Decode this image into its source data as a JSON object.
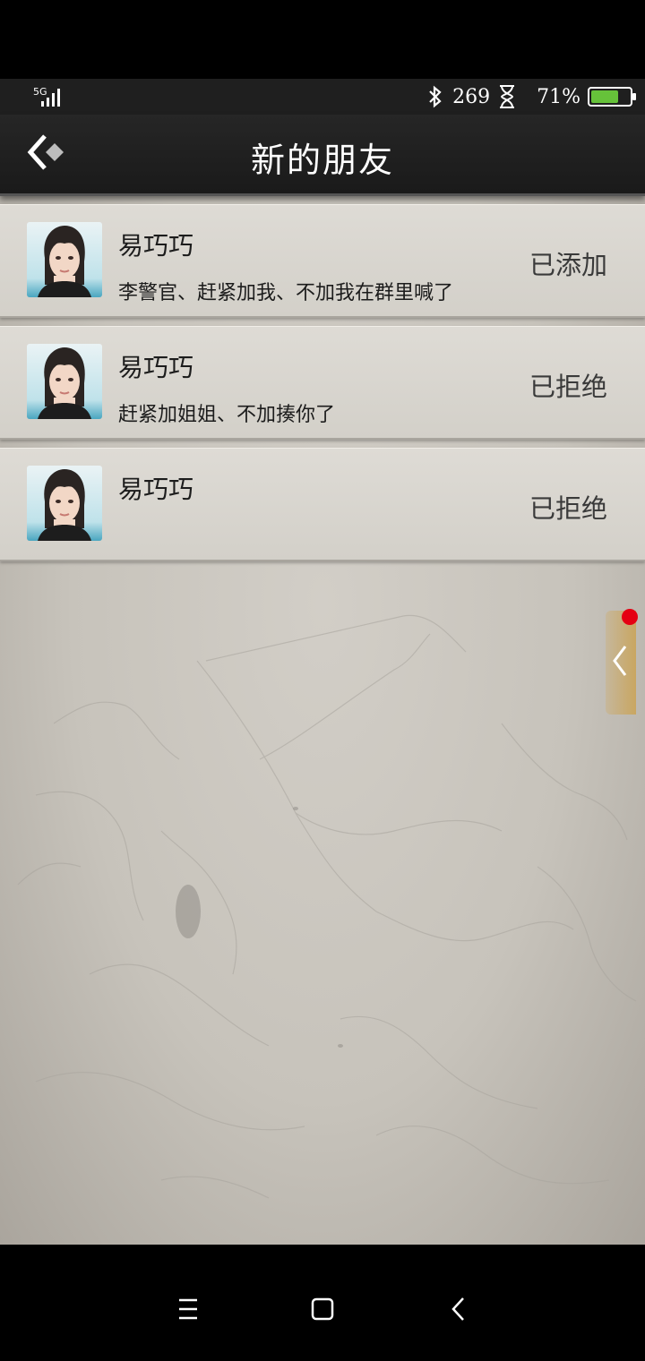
{
  "statusbar": {
    "network": "5G",
    "speed": "269",
    "battery_text": "71%",
    "battery_level": 0.71,
    "battery_color": "#66c23a"
  },
  "header": {
    "title": "新的朋友",
    "back_icon": "back-diamond-icon"
  },
  "requests": [
    {
      "name": "易巧巧",
      "message": "李警官、赶紧加我、不加我在群里喊了",
      "status": "已添加"
    },
    {
      "name": "易巧巧",
      "message": "赶紧加姐姐、不加揍你了",
      "status": "已拒绝"
    },
    {
      "name": "易巧巧",
      "message": "",
      "status": "已拒绝"
    }
  ],
  "side_tab": {
    "icon": "chevron-left-icon",
    "badge_color": "#e50012"
  },
  "navbar": {
    "icons": [
      "menu-icon",
      "home-icon",
      "back-icon"
    ]
  }
}
